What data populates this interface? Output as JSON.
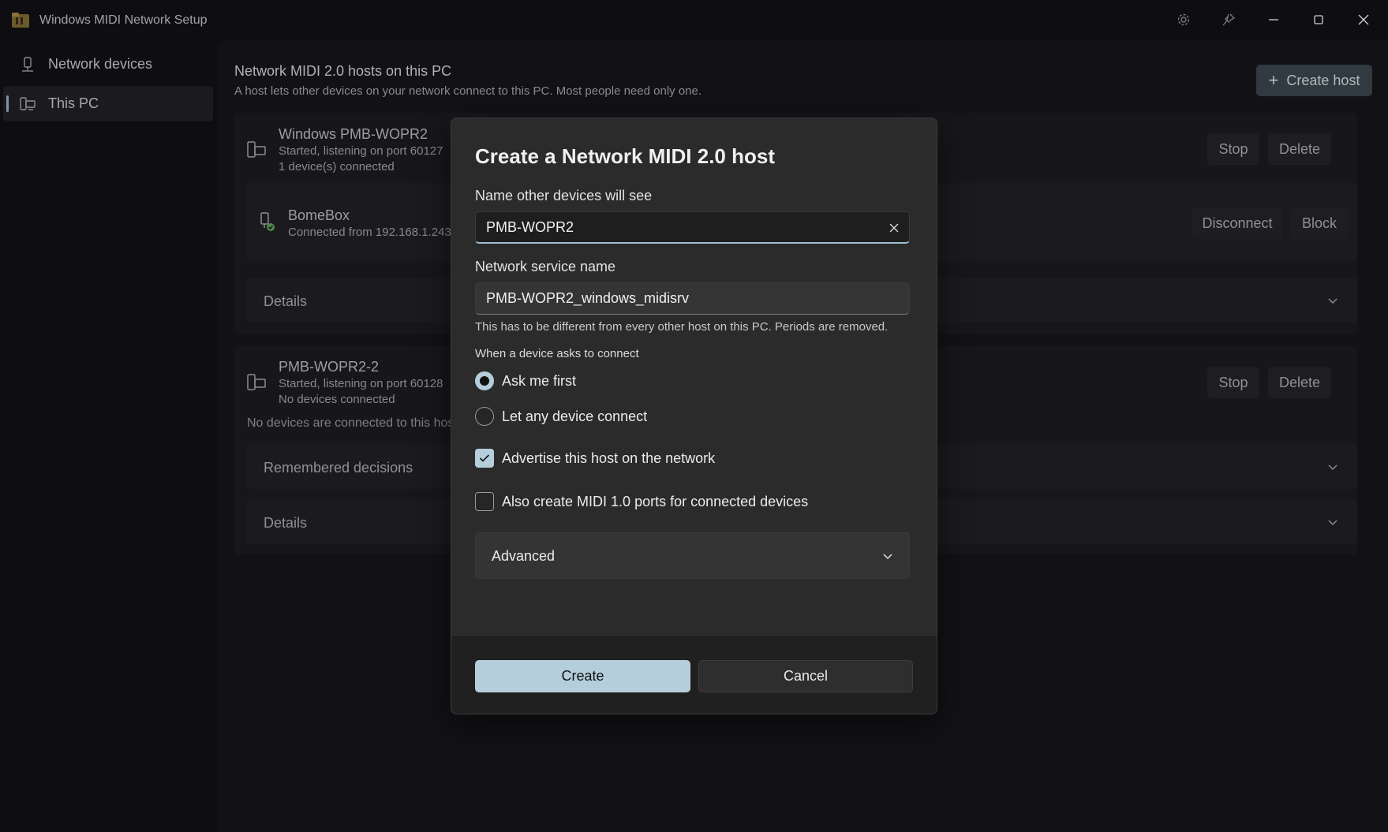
{
  "window": {
    "title": "Windows MIDI Network Setup",
    "icons": [
      "app-icon",
      "settings-icon",
      "pin-icon",
      "minimize-icon",
      "maximize-icon",
      "close-icon"
    ]
  },
  "sidebar": {
    "items": [
      {
        "label": "Network devices",
        "icon": "network-device-icon",
        "selected": false
      },
      {
        "label": "This PC",
        "icon": "pc-icon",
        "selected": true
      }
    ]
  },
  "main": {
    "title": "Network MIDI 2.0 hosts on this PC",
    "subtitle": "A host lets other devices on your network connect to this PC. Most people need only one.",
    "create_host_label": "Create host",
    "hosts": [
      {
        "name": "Windows PMB-WOPR2",
        "status": "Started, listening on port 60127",
        "connections": "1 device(s) connected",
        "stop_label": "Stop",
        "delete_label": "Delete",
        "device": {
          "name": "BomeBox",
          "detail": "Connected from 192.168.1.243,",
          "disconnect_label": "Disconnect",
          "block_label": "Block"
        },
        "details_label": "Details"
      },
      {
        "name": "PMB-WOPR2-2",
        "status": "Started, listening on port 60128",
        "connections": "No devices connected",
        "stop_label": "Stop",
        "delete_label": "Delete",
        "empty_text": "No devices are connected to this host.",
        "remembered_label": "Remembered decisions",
        "details_label": "Details"
      }
    ]
  },
  "dialog": {
    "title": "Create a Network MIDI 2.0 host",
    "name_label": "Name other devices will see",
    "name_value": "PMB-WOPR2",
    "service_label": "Network service name",
    "service_value": "PMB-WOPR2_windows_midisrv",
    "service_help": "This has to be different from every other host on this PC. Periods are removed.",
    "connect_label": "When a device asks to connect",
    "radio_ask": "Ask me first",
    "radio_any": "Let any device connect",
    "selected_radio": "Ask me first",
    "advertise_label": "Advertise this host on the network",
    "advertise_checked": true,
    "midi1_label": "Also create MIDI 1.0 ports for connected devices",
    "midi1_checked": false,
    "advanced_label": "Advanced",
    "create_label": "Create",
    "cancel_label": "Cancel",
    "accent_color": "#b5cedb"
  }
}
